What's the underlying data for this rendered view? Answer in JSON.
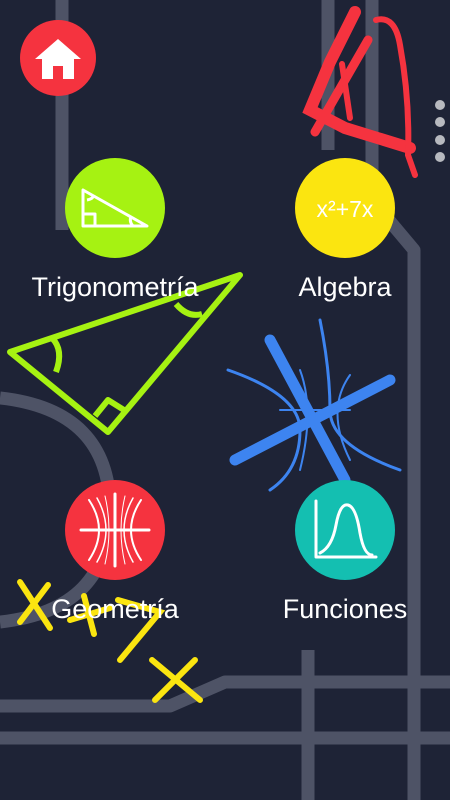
{
  "colors": {
    "background": "#1e2336",
    "road": "#4e5366",
    "home": "#f5333f",
    "trig": "#a6f212",
    "algebra": "#fbe510",
    "geometry": "#f5333f",
    "functions": "#14bfb1"
  },
  "home_button": {
    "icon": "home-icon"
  },
  "overflow_menu": {
    "icon": "more-vertical-icon"
  },
  "topics": [
    {
      "id": "trigonometry",
      "label": "Trigonometría",
      "icon": "right-triangle-icon"
    },
    {
      "id": "algebra",
      "label": "Algebra",
      "icon": "algebra-expression-icon",
      "icon_text": "x²+7x"
    },
    {
      "id": "geometry",
      "label": "Geometría",
      "icon": "conic-curves-icon"
    },
    {
      "id": "functions",
      "label": "Funciones",
      "icon": "function-graph-icon"
    }
  ]
}
